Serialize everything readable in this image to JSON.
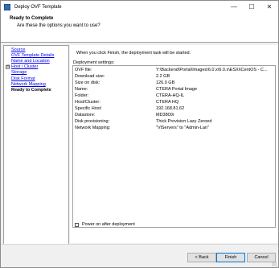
{
  "window": {
    "title": "Deploy OVF Template",
    "controls": {
      "minimize": "—",
      "maximize": "☐",
      "close": "✕"
    }
  },
  "header": {
    "title": "Ready to Complete",
    "subtitle": "Are these the options you want to use?"
  },
  "nav": {
    "items": [
      {
        "label": "Source",
        "current": false
      },
      {
        "label": "OVF Template Details",
        "current": false
      },
      {
        "label": "Name and Location",
        "current": false
      },
      {
        "label": "Host / Cluster",
        "current": false,
        "expandable": true,
        "expander": "⊟"
      },
      {
        "label": "Storage",
        "current": false
      },
      {
        "label": "Disk Format",
        "current": false
      },
      {
        "label": "Network Mapping",
        "current": false
      },
      {
        "label": "Ready to Complete",
        "current": true
      }
    ]
  },
  "main": {
    "intro": "When you click Finish, the deployment task will be started.",
    "settings_label": "Deployment settings:",
    "settings": [
      {
        "key": "OVF file:",
        "value": "Y:\\Backend\\Portal\\Images\\6.0.x\\6.0.x\\ESXi\\CentOS - C..."
      },
      {
        "key": "Download size:",
        "value": "2.2 GB"
      },
      {
        "key": "Size on disk:",
        "value": "126.0 GB"
      },
      {
        "key": "Name:",
        "value": "CTERA Portal Image"
      },
      {
        "key": "Folder:",
        "value": "CTERA-HQ-IL"
      },
      {
        "key": "Host/Cluster:",
        "value": "CTERA HQ"
      },
      {
        "key": "Specific Host:",
        "value": "192.168.81.62"
      },
      {
        "key": "Datastore:",
        "value": "MD3800i"
      },
      {
        "key": "Disk provisioning:",
        "value": "Thick Provision Lazy Zeroed"
      },
      {
        "key": "Network Mapping:",
        "value": "\"VlServers\" to \"Admin-Lan\""
      }
    ],
    "power_on_label": "Power on after deployment",
    "power_on_checked": false
  },
  "footer": {
    "back": "< Back",
    "finish": "Finish",
    "cancel": "Cancel"
  }
}
